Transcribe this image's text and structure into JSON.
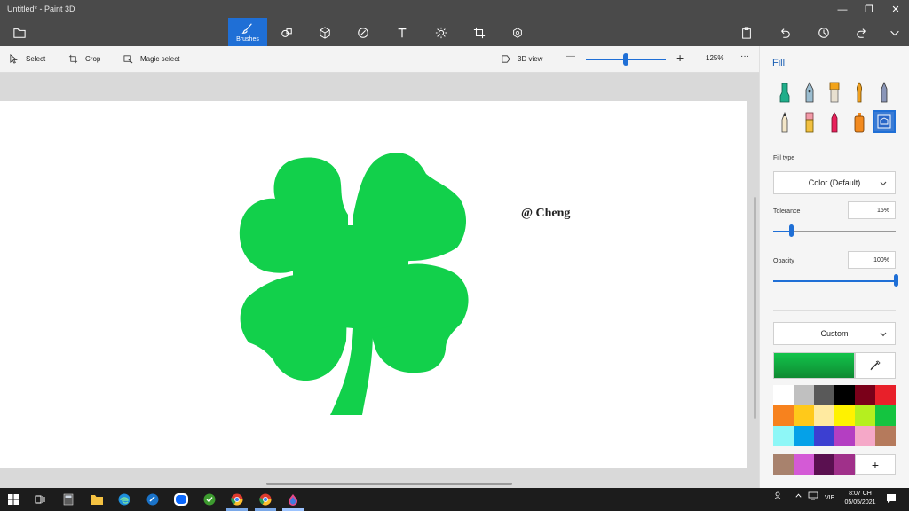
{
  "window": {
    "title": "Untitled* - Paint 3D",
    "controls": [
      "—",
      "❐",
      "✕"
    ]
  },
  "toolbar": {
    "brushes_label": "Brushes"
  },
  "subtoolbar": {
    "select_label": "Select",
    "crop_label": "Crop",
    "magic_select_label": "Magic select",
    "view_3d_label": "3D view",
    "zoom_minus": "—",
    "zoom_plus": "+",
    "zoom_level": "125%",
    "more": "···",
    "zoom_fraction": 0.5
  },
  "canvas": {
    "watermark": "@ Cheng",
    "shape_color": "#12d04b"
  },
  "panel": {
    "title": "Fill",
    "fill_type_label": "Fill type",
    "fill_type_value": "Color (Default)",
    "tolerance_label": "Tolerance",
    "tolerance_value": "15%",
    "tolerance_fraction": 0.15,
    "opacity_label": "Opacity",
    "opacity_value": "100%",
    "opacity_fraction": 1.0,
    "color_mode_value": "Custom",
    "selected_color": "#12c44b",
    "palette": [
      "#ffffff",
      "#c0c0c0",
      "#595959",
      "#000000",
      "#7a0019",
      "#e8202a",
      "#f7821e",
      "#ffc91a",
      "#ffeaa0",
      "#fff200",
      "#b5ef1f",
      "#14c440",
      "#8ef7f7",
      "#05a1e8",
      "#3c3fd1",
      "#b43ec2",
      "#f5a8c8",
      "#b57a5c"
    ],
    "custom_colors": [
      "#a8826d",
      "#d45ad6",
      "#5a1050",
      "#a0308a"
    ],
    "add_color": "+"
  },
  "taskbar": {
    "language": "VIE",
    "time": "8:07 CH",
    "date": "05/05/2021"
  }
}
